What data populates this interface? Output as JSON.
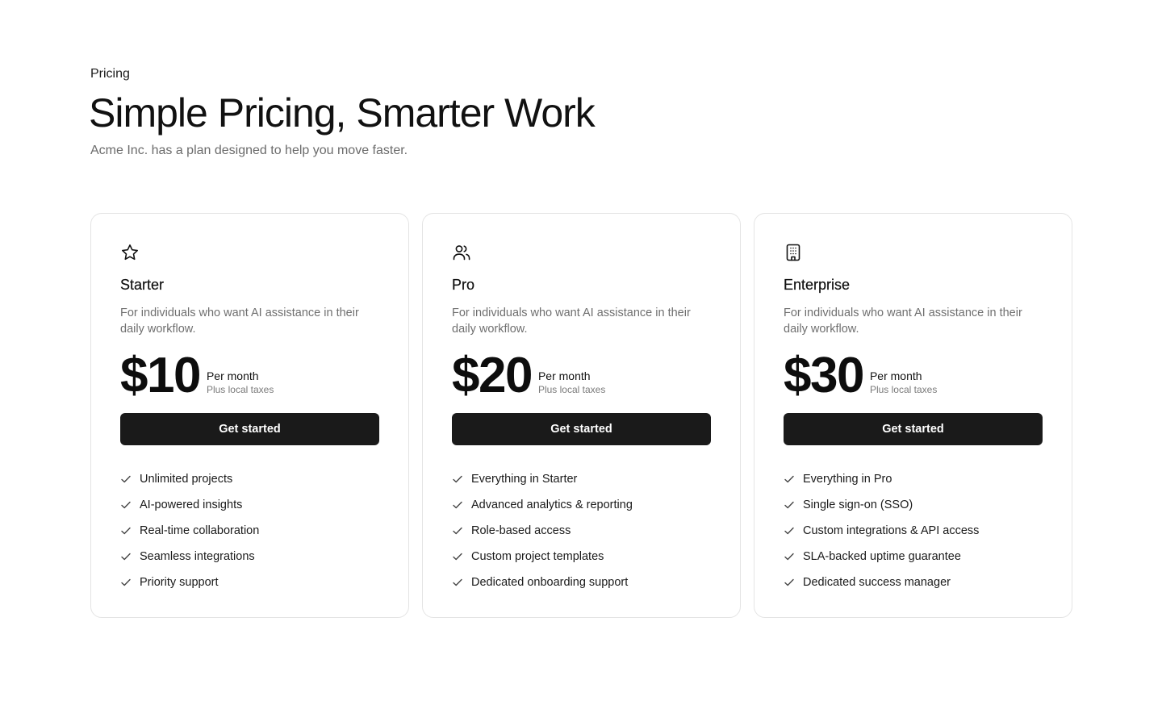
{
  "header": {
    "eyebrow": "Pricing",
    "title": "Simple Pricing, Smarter Work",
    "subtitle": "Acme Inc. has a plan designed to help you move faster."
  },
  "plans": [
    {
      "icon": "star-icon",
      "name": "Starter",
      "description": "For individuals who want AI assistance in their daily workflow.",
      "price": "$10",
      "period": "Per month",
      "tax_note": "Plus local taxes",
      "cta": "Get started",
      "features": [
        "Unlimited projects",
        "AI-powered insights",
        "Real-time collaboration",
        "Seamless integrations",
        "Priority support"
      ]
    },
    {
      "icon": "users-icon",
      "name": "Pro",
      "description": "For individuals who want AI assistance in their daily workflow.",
      "price": "$20",
      "period": "Per month",
      "tax_note": "Plus local taxes",
      "cta": "Get started",
      "features": [
        "Everything in Starter",
        "Advanced analytics & reporting",
        "Role-based access",
        "Custom project templates",
        "Dedicated onboarding support"
      ]
    },
    {
      "icon": "building-icon",
      "name": "Enterprise",
      "description": "For individuals who want AI assistance in their daily workflow.",
      "price": "$30",
      "period": "Per month",
      "tax_note": "Plus local taxes",
      "cta": "Get started",
      "features": [
        "Everything in Pro",
        "Single sign-on (SSO)",
        "Custom integrations & API access",
        "SLA-backed uptime guarantee",
        "Dedicated success manager"
      ]
    }
  ],
  "colors": {
    "button_bg": "#1a1a1a",
    "button_text": "#ffffff",
    "muted_text": "#6f6f6f",
    "card_border": "#e4e4e4"
  }
}
